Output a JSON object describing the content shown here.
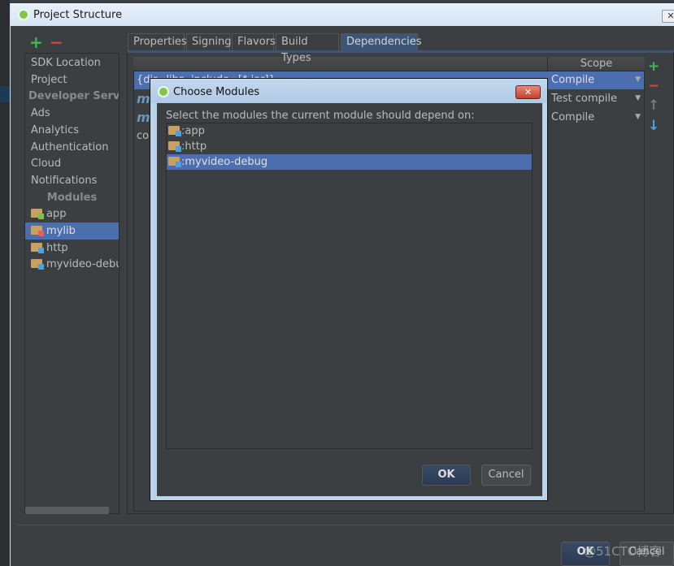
{
  "window": {
    "title": "Project Structure",
    "close_icon": "close-icon"
  },
  "sidebar": {
    "items": [
      {
        "label": "SDK Location",
        "type": "item"
      },
      {
        "label": "Project",
        "type": "item"
      },
      {
        "label": "Developer Services",
        "type": "header"
      },
      {
        "label": "Ads",
        "type": "item"
      },
      {
        "label": "Analytics",
        "type": "item"
      },
      {
        "label": "Authentication",
        "type": "item"
      },
      {
        "label": "Cloud",
        "type": "item"
      },
      {
        "label": "Notifications",
        "type": "item"
      },
      {
        "label": "Modules",
        "type": "header"
      },
      {
        "label": "app",
        "type": "module",
        "icon": "android-app-module-icon"
      },
      {
        "label": "mylib",
        "type": "module",
        "icon": "library-module-icon",
        "selected": true
      },
      {
        "label": "http",
        "type": "module",
        "icon": "java-module-icon"
      },
      {
        "label": "myvideo-debug",
        "type": "module",
        "icon": "java-module-icon"
      }
    ]
  },
  "tabs": [
    {
      "label": "Properties"
    },
    {
      "label": "Signing"
    },
    {
      "label": "Flavors"
    },
    {
      "label": "Build Types"
    },
    {
      "label": "Dependencies",
      "active": true
    }
  ],
  "dependencies": {
    "scope_header": "Scope",
    "rows": [
      {
        "name": "{dir=libs, include=[*.jar]}",
        "scope": "Compile",
        "selected": true
      },
      {
        "name": "m",
        "scope": "Test compile"
      },
      {
        "name": "m",
        "scope": "Compile"
      },
      {
        "name": "co",
        "scope": ""
      }
    ]
  },
  "modal": {
    "title": "Choose Modules",
    "prompt": "Select the modules the current module should depend on:",
    "modules": [
      {
        "label": ":app"
      },
      {
        "label": ":http"
      },
      {
        "label": ":myvideo-debug",
        "selected": true
      }
    ],
    "ok": "OK",
    "cancel": "Cancel"
  },
  "footer": {
    "ok": "OK",
    "cancel": "Cancel"
  },
  "watermark": "@51CTO博客",
  "colors": {
    "selection": "#4b6eaf",
    "background": "#3c3f41",
    "add": "#3fb950",
    "remove": "#d9463c"
  }
}
